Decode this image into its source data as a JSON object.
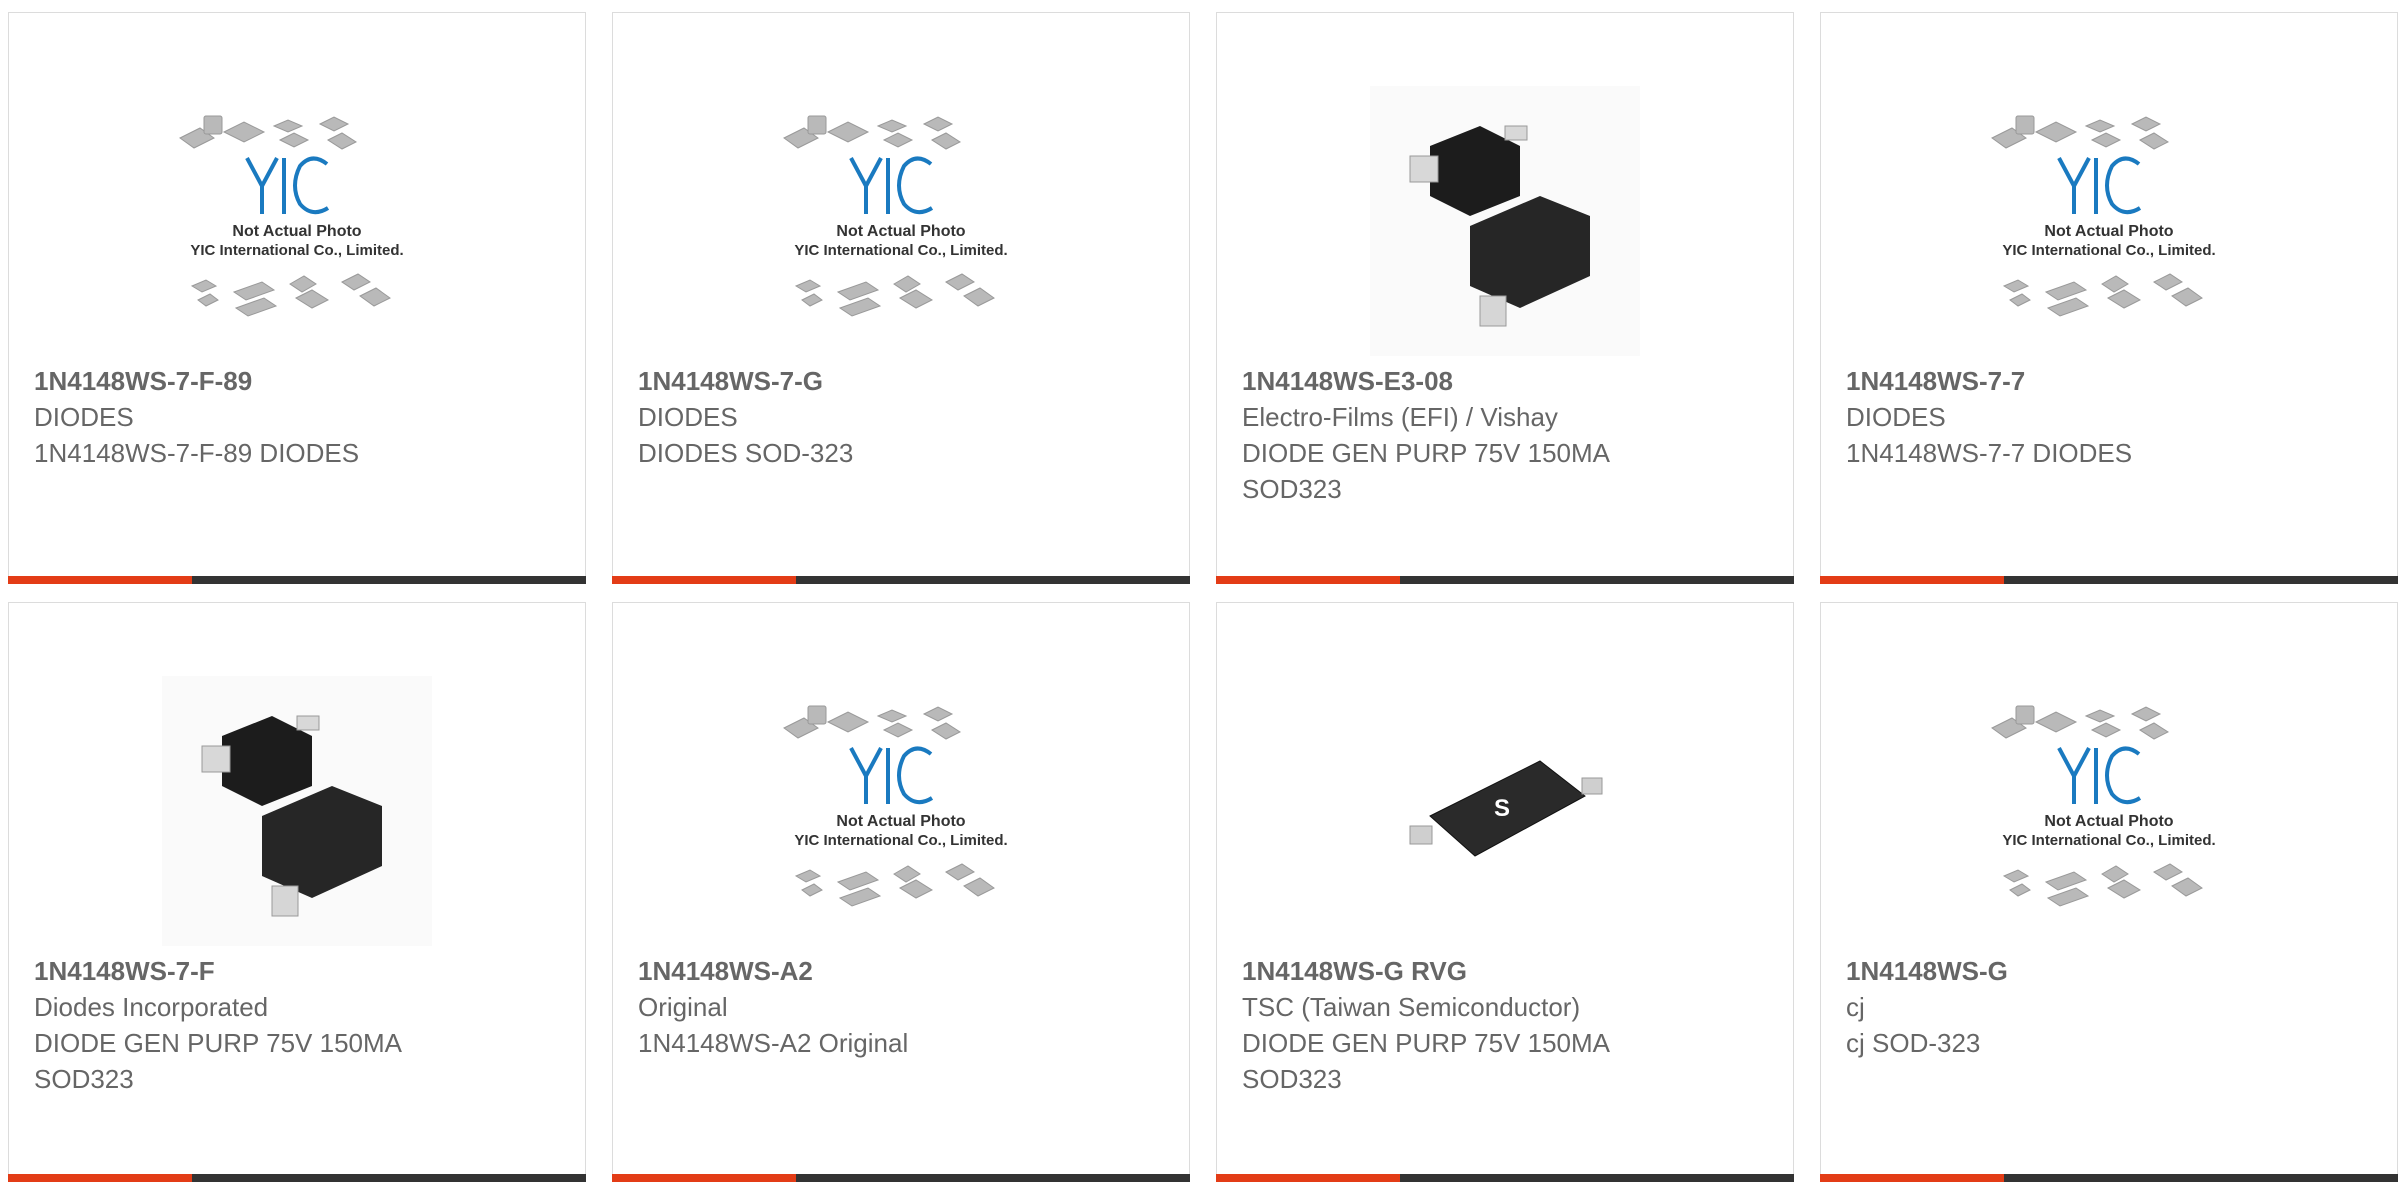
{
  "placeholder": {
    "line1": "Not Actual Photo",
    "line2": "YIC International Co., Limited.",
    "logo": "YIC"
  },
  "products": [
    {
      "part": "1N4148WS-7-F-89",
      "manufacturer": "DIODES",
      "description": "1N4148WS-7-F-89 DIODES",
      "image": "yic-placeholder"
    },
    {
      "part": "1N4148WS-7-G",
      "manufacturer": "DIODES",
      "description": "DIODES SOD-323",
      "image": "yic-placeholder"
    },
    {
      "part": "1N4148WS-E3-08",
      "manufacturer": "Electro-Films (EFI) / Vishay",
      "description": "DIODE GEN PURP 75V 150MA SOD323",
      "image": "sod323-photo"
    },
    {
      "part": "1N4148WS-7-7",
      "manufacturer": "DIODES",
      "description": "1N4148WS-7-7 DIODES",
      "image": "yic-placeholder"
    },
    {
      "part": "1N4148WS-7-F",
      "manufacturer": "Diodes Incorporated",
      "description": "DIODE GEN PURP 75V 150MA SOD323",
      "image": "sod323-photo"
    },
    {
      "part": "1N4148WS-A2",
      "manufacturer": "Original",
      "description": "1N4148WS-A2 Original",
      "image": "yic-placeholder"
    },
    {
      "part": "1N4148WS-G RVG",
      "manufacturer": "TSC (Taiwan Semiconductor)",
      "description": "DIODE GEN PURP 75V 150MA SOD323",
      "image": "tsc-sod323-photo"
    },
    {
      "part": "1N4148WS-G",
      "manufacturer": "cj",
      "description": "cj SOD-323",
      "image": "yic-placeholder"
    }
  ],
  "colors": {
    "accent": "#e33c16",
    "bar": "#333333",
    "border": "#dcdcdc",
    "text": "#666666"
  }
}
